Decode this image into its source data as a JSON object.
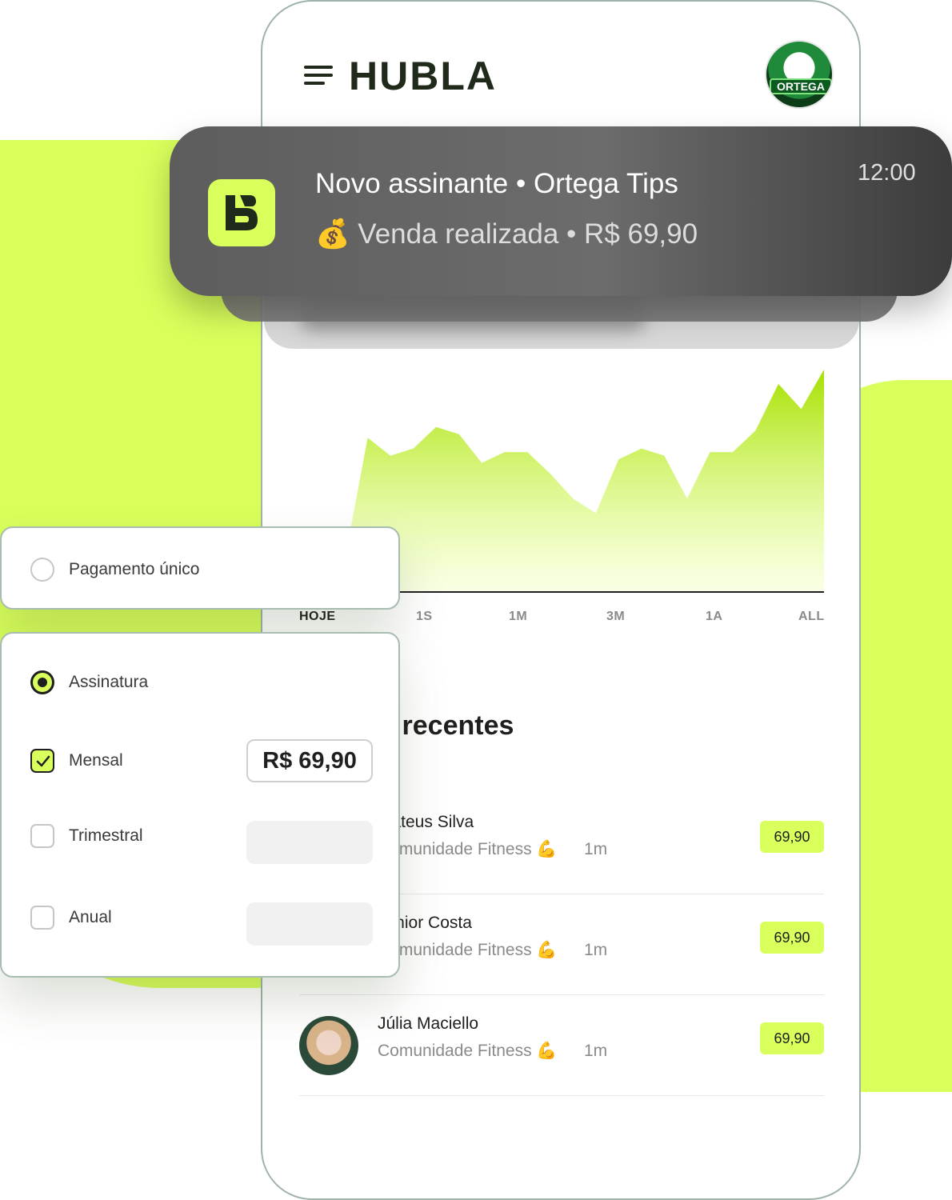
{
  "app": {
    "logo": "HUBLA",
    "creator_badge": "ORTEGA"
  },
  "notification": {
    "title": "Novo assinante • Ortega Tips",
    "body": "💰 Venda realizada • R$ 69,90",
    "time": "12:00"
  },
  "chart_data": {
    "type": "area",
    "values": [
      10,
      14,
      9,
      43,
      38,
      40,
      46,
      44,
      36,
      39,
      39,
      33,
      26,
      22,
      37,
      40,
      38,
      26,
      39,
      39,
      45,
      58,
      51,
      62
    ],
    "color": "#b5e61d"
  },
  "periods": [
    "HOJE",
    "1S",
    "1M",
    "3M",
    "1A",
    "ALL"
  ],
  "active_period": "HOJE",
  "section": {
    "title": "Vendas recentes"
  },
  "sales": [
    {
      "name": "Mateus Silva",
      "product": "Comunidade Fitness 💪",
      "time": "1m",
      "amount": "69,90"
    },
    {
      "name": "Júnior Costa",
      "product": "Comunidade Fitness 💪",
      "time": "1m",
      "amount": "69,90"
    },
    {
      "name": "Júlia Maciello",
      "product": "Comunidade Fitness 💪",
      "time": "1m",
      "amount": "69,90"
    }
  ],
  "payment": {
    "single_label": "Pagamento único",
    "subscription_label": "Assinatura",
    "options": [
      {
        "label": "Mensal",
        "checked": true,
        "price": "R$ 69,90"
      },
      {
        "label": "Trimestral",
        "checked": false,
        "price": ""
      },
      {
        "label": "Anual",
        "checked": false,
        "price": ""
      }
    ]
  },
  "colors": {
    "accent": "#d9ff5c",
    "dark": "#1f2a1a",
    "frame": "#9fb3a8"
  }
}
